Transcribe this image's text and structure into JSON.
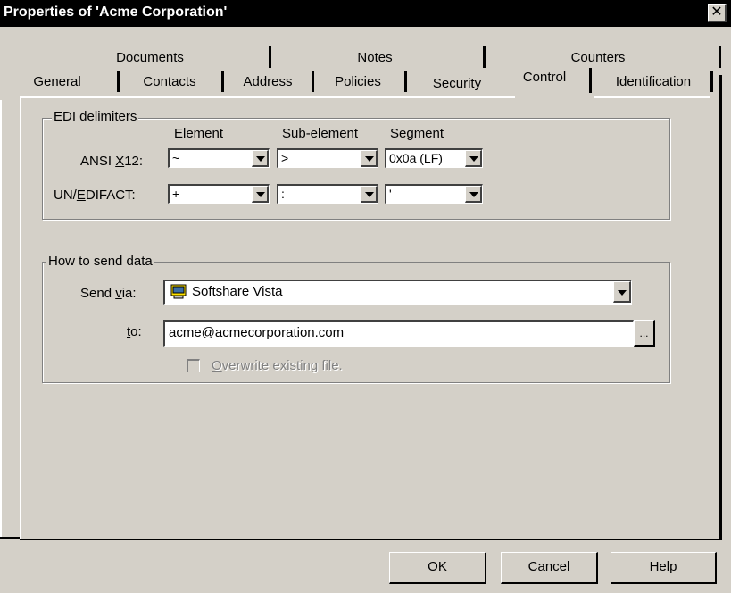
{
  "window": {
    "title": "Properties of 'Acme Corporation'",
    "close_glyph": "✕"
  },
  "tabs": {
    "row_back": [
      "Documents",
      "Notes",
      "Counters"
    ],
    "row_front": [
      "General",
      "Contacts",
      "Address",
      "Policies",
      "Security",
      "Control",
      "Identification"
    ],
    "selected": "Control"
  },
  "edi": {
    "legend": "EDI delimiters",
    "col_element": "Element",
    "col_subelement": "Sub-element",
    "col_segment": "Segment",
    "ansi": {
      "label_pre": "ANSI ",
      "label_u": "X",
      "label_post": "12:",
      "element": "~",
      "subelement": ">",
      "segment": "0x0a (LF)"
    },
    "edifact": {
      "label_pre": "UN/",
      "label_u": "E",
      "label_post": "DIFACT:",
      "element": "+",
      "subelement": ":",
      "segment": "'"
    }
  },
  "send": {
    "legend": "How to send data",
    "via_label_pre": "Send ",
    "via_label_u": "v",
    "via_label_post": "ia:",
    "via_value": "Softshare Vista",
    "via_icon": "softshare-vista-icon",
    "to_label_u": "t",
    "to_label_post": "o:",
    "to_value": "acme@acmecorporation.com",
    "browse_label": "...",
    "overwrite_u": "O",
    "overwrite_post": "verwrite existing file.",
    "overwrite_checked": false
  },
  "buttons": {
    "ok": "OK",
    "cancel": "Cancel",
    "help": "Help"
  }
}
